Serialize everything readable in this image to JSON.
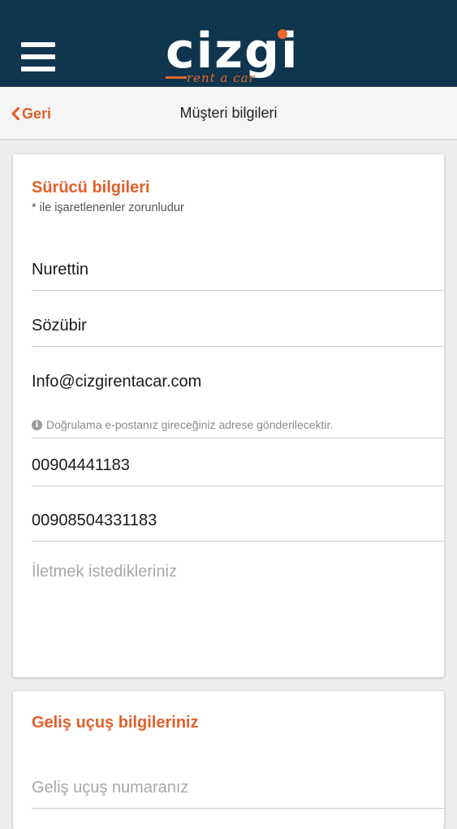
{
  "header": {
    "logo_main": "cizgi",
    "logo_sub": "rent a car",
    "menu_icon": "hamburger-icon",
    "brand_accent": "#e9692c",
    "bar_color": "#10354f"
  },
  "subheader": {
    "back_label": "Geri",
    "title": "Müşteri bilgileri"
  },
  "driver": {
    "title": "Sürücü bilgileri",
    "required_note": "* ile işaretlenenler zorunludur",
    "first_name": "Nurettin",
    "last_name": "Sözübir",
    "email": "Info@cizgirentacar.com",
    "email_hint": "Doğrulama e-postanız gireceğiniz adrese gönderilecektir.",
    "phone": "00904441183",
    "mobile": "00908504331183",
    "message_placeholder": "İletmek istedikleriniz"
  },
  "flight": {
    "title": "Geliş uçuş bilgileriniz",
    "flight_number_placeholder": "Geliş uçuş numaranız"
  }
}
